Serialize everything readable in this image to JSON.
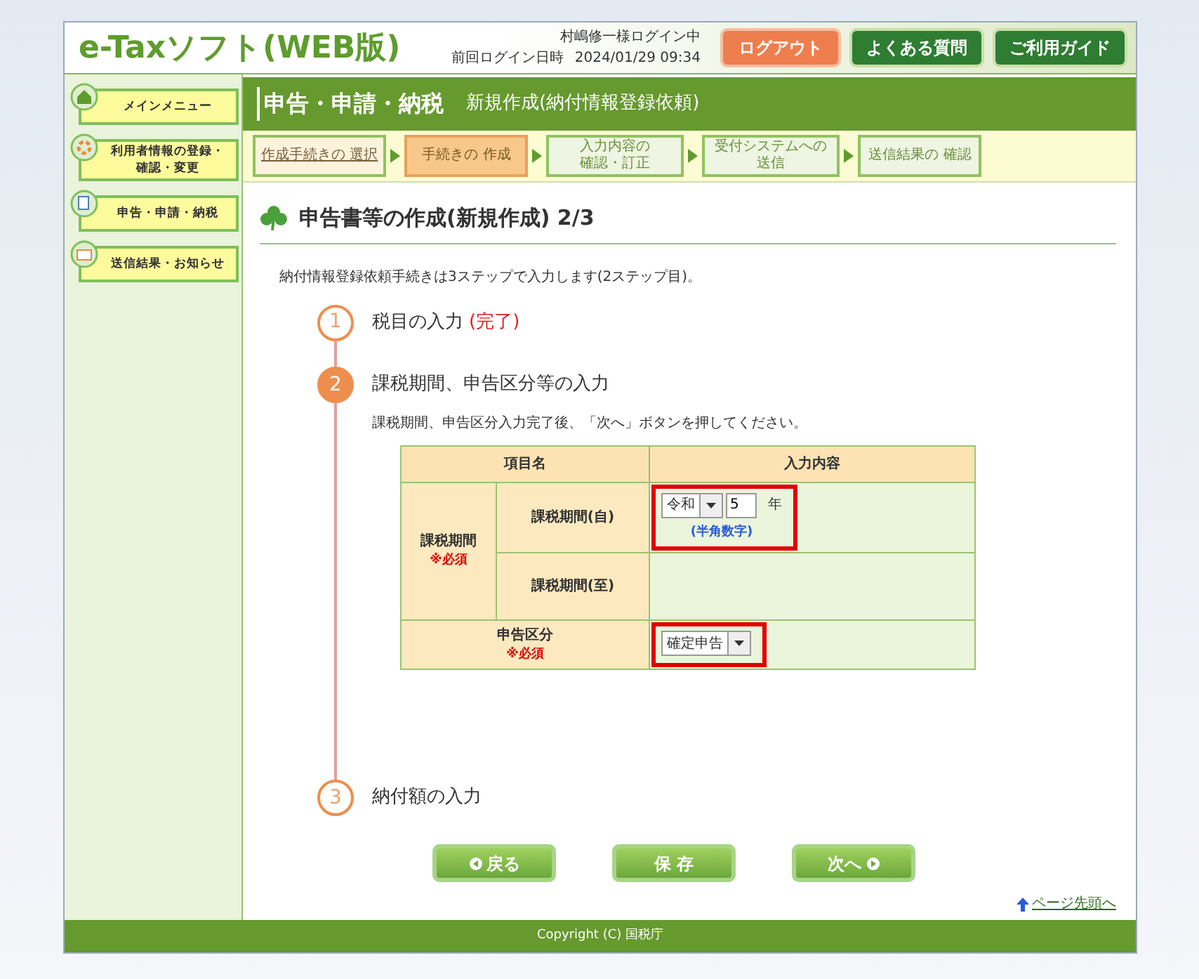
{
  "header": {
    "logo": "e-Taxソフト(WEB版)",
    "user": "村嶋修一様ログイン中",
    "last_login_label": "前回ログイン日時",
    "last_login": "2024/01/29 09:34",
    "buttons": [
      {
        "label": "ログアウト",
        "kind": "logout"
      },
      {
        "label": "よくある質問",
        "kind": "nav"
      },
      {
        "label": "ご利用ガイド",
        "kind": "nav"
      }
    ]
  },
  "sidebar": {
    "items": [
      {
        "lines": [
          "メインメニュー"
        ]
      },
      {
        "lines": [
          "利用者情報の登録・",
          "確認・変更"
        ]
      },
      {
        "lines": [
          "申告・申請・納税"
        ]
      },
      {
        "lines": [
          "送信結果・お知らせ"
        ]
      }
    ]
  },
  "page_header": {
    "title": "申告・申請・納税",
    "subtitle": "新規作成(納付情報登録依頼)"
  },
  "steps": [
    {
      "lines": [
        "作成手続きの 選択"
      ],
      "selected": false,
      "kind": "link"
    },
    {
      "lines": [
        "手続きの 作成"
      ],
      "selected": true,
      "kind": "plain"
    },
    {
      "lines": [
        "入力内容の",
        "確認・訂正"
      ],
      "selected": false,
      "kind": "plain"
    },
    {
      "lines": [
        "受付システムへの",
        "送信"
      ],
      "selected": false,
      "kind": "plain"
    },
    {
      "lines": [
        "送信結果の 確認"
      ],
      "selected": false,
      "kind": "plain"
    }
  ],
  "section": {
    "title": "申告書等の作成(新規作成) 2/3",
    "intro": "納付情報登録依頼手続きは3ステップで入力します(2ステップ目)。"
  },
  "timeline": [
    {
      "number": "1",
      "title": "税目の入力",
      "status": "(完了)",
      "selected": false
    },
    {
      "number": "2",
      "title": "課税期間、申告区分等の入力",
      "selected": true,
      "note": "課税期間、申告区分入力完了後、「次へ」ボタンを押してください。"
    },
    {
      "number": "3",
      "title": "納付額の入力",
      "selected": false
    }
  ],
  "form_table": {
    "columns": [
      "項目名",
      "入力内容"
    ],
    "group": {
      "label": "課税期間",
      "required": "※必須",
      "rows": [
        {
          "label": "課税期間(自)",
          "highlighted": true,
          "era": "令和",
          "year": "5",
          "unit": "年",
          "hint": "(半角数字)"
        },
        {
          "label": "課税期間(至)",
          "highlighted": false
        }
      ]
    },
    "filing": {
      "label": "申告区分",
      "required": "※必須",
      "highlighted": true,
      "value": "確定申告"
    }
  },
  "buttons": [
    {
      "label": "戻る",
      "kind": "back"
    },
    {
      "label": "保 存",
      "kind": "save"
    },
    {
      "label": "次へ",
      "kind": "next"
    }
  ],
  "top_link": "ページ先頭へ",
  "footer": "Copyright (C) 国税庁"
}
